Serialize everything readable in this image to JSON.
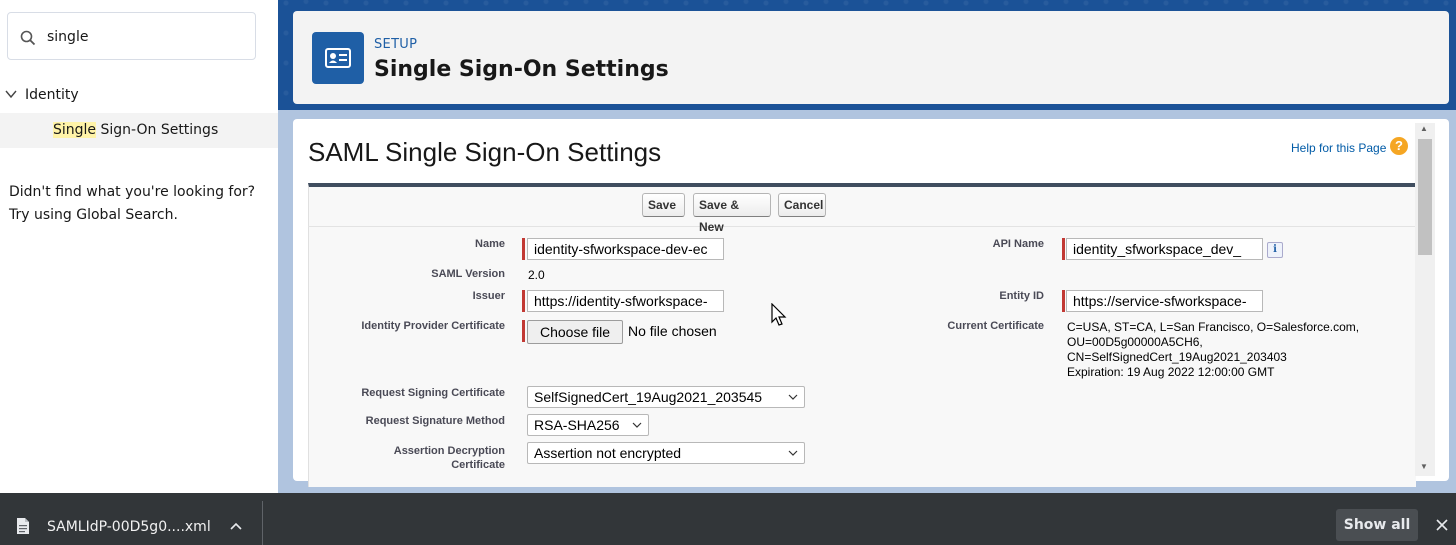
{
  "sidebar": {
    "search_value": "single",
    "tree": {
      "parent_label": "Identity",
      "child_highlight": "Single",
      "child_rest": " Sign-On Settings"
    },
    "not_found_line1": "Didn't find what you're looking for?",
    "not_found_line2": "Try using Global Search."
  },
  "header": {
    "breadcrumb": "SETUP",
    "title": "Single Sign-On Settings"
  },
  "content": {
    "title": "SAML Single Sign-On Settings",
    "help_link": "Help for this Page",
    "help_icon": "?",
    "buttons": {
      "save": "Save",
      "save_new": "Save & New",
      "cancel": "Cancel"
    },
    "fields": {
      "name_label": "Name",
      "name_value": "identity-sfworkspace-dev-ec",
      "api_name_label": "API Name",
      "api_name_value": "identity_sfworkspace_dev_",
      "saml_version_label": "SAML Version",
      "saml_version_value": "2.0",
      "issuer_label": "Issuer",
      "issuer_value": "https://identity-sfworkspace-",
      "entity_id_label": "Entity ID",
      "entity_id_value": "https://service-sfworkspace-",
      "idp_cert_label": "Identity Provider Certificate",
      "choose_file": "Choose file",
      "no_file": "No file chosen",
      "current_cert_label": "Current Certificate",
      "current_cert_line1": "C=USA, ST=CA, L=San Francisco, O=Salesforce.com,",
      "current_cert_line2": "OU=00D5g00000A5CH6,",
      "current_cert_line3": "CN=SelfSignedCert_19Aug2021_203403",
      "current_cert_line4": "Expiration: 19 Aug 2022 12:00:00 GMT",
      "req_sign_cert_label": "Request Signing Certificate",
      "req_sign_cert_value": "SelfSignedCert_19Aug2021_203545",
      "req_sig_method_label": "Request Signature Method",
      "req_sig_method_value": "RSA-SHA256",
      "assertion_decrypt_label_1": "Assertion Decryption",
      "assertion_decrypt_label_2": "Certificate",
      "assertion_decrypt_value": "Assertion not encrypted"
    }
  },
  "download_bar": {
    "file_name": "SAMLIdP-00D5g0....xml",
    "show_all": "Show all"
  },
  "colors": {
    "brand_blue": "#1f5fa6",
    "required": "#c23934",
    "help_orange": "#f5a623"
  }
}
